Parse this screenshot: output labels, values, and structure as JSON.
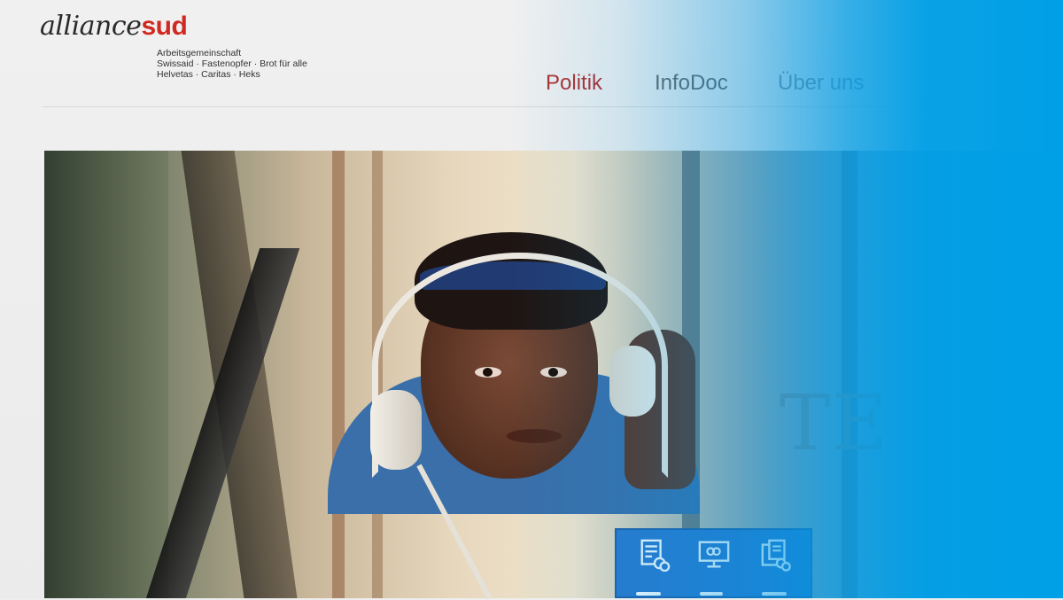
{
  "logo": {
    "word_a": "alliance",
    "word_b": "sud",
    "tagline_lines": [
      "Arbeitsgemeinschaft",
      "Swissaid · Fastenopfer · Brot für alle",
      "Helvetas · Caritas · Heks"
    ]
  },
  "nav": {
    "items": [
      {
        "label": "Politik",
        "active": true
      },
      {
        "label": "InfoDoc",
        "active": false
      },
      {
        "label": "Über uns",
        "active": false
      }
    ]
  },
  "hero": {
    "text_fragment": "TE"
  },
  "icons": {
    "tiles": [
      "document-link-icon",
      "monitor-link-icon",
      "documents-link-icon"
    ]
  },
  "colors": {
    "brand_red": "#d02a20",
    "nav_active": "#b03030",
    "overlay_blue": "#00a0e6",
    "panel_blue": "#2c78cc"
  }
}
